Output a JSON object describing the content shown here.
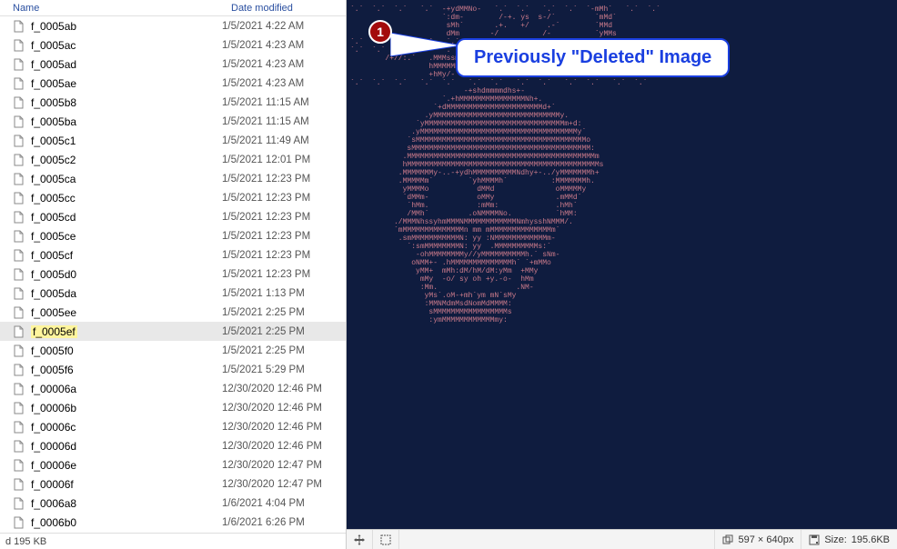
{
  "columns": {
    "name": "Name",
    "date": "Date modified"
  },
  "files": [
    {
      "name": "f_0005ab",
      "date": "1/5/2021 4:22 AM",
      "selected": false
    },
    {
      "name": "f_0005ac",
      "date": "1/5/2021 4:23 AM",
      "selected": false
    },
    {
      "name": "f_0005ad",
      "date": "1/5/2021 4:23 AM",
      "selected": false
    },
    {
      "name": "f_0005ae",
      "date": "1/5/2021 4:23 AM",
      "selected": false
    },
    {
      "name": "f_0005b8",
      "date": "1/5/2021 11:15 AM",
      "selected": false
    },
    {
      "name": "f_0005ba",
      "date": "1/5/2021 11:15 AM",
      "selected": false
    },
    {
      "name": "f_0005c1",
      "date": "1/5/2021 11:49 AM",
      "selected": false
    },
    {
      "name": "f_0005c2",
      "date": "1/5/2021 12:01 PM",
      "selected": false
    },
    {
      "name": "f_0005ca",
      "date": "1/5/2021 12:23 PM",
      "selected": false
    },
    {
      "name": "f_0005cc",
      "date": "1/5/2021 12:23 PM",
      "selected": false
    },
    {
      "name": "f_0005cd",
      "date": "1/5/2021 12:23 PM",
      "selected": false
    },
    {
      "name": "f_0005ce",
      "date": "1/5/2021 12:23 PM",
      "selected": false
    },
    {
      "name": "f_0005cf",
      "date": "1/5/2021 12:23 PM",
      "selected": false
    },
    {
      "name": "f_0005d0",
      "date": "1/5/2021 12:23 PM",
      "selected": false
    },
    {
      "name": "f_0005da",
      "date": "1/5/2021 1:13 PM",
      "selected": false
    },
    {
      "name": "f_0005ee",
      "date": "1/5/2021 2:25 PM",
      "selected": false
    },
    {
      "name": "f_0005ef",
      "date": "1/5/2021 2:25 PM",
      "selected": true
    },
    {
      "name": "f_0005f0",
      "date": "1/5/2021 2:25 PM",
      "selected": false
    },
    {
      "name": "f_0005f6",
      "date": "1/5/2021 5:29 PM",
      "selected": false
    },
    {
      "name": "f_00006a",
      "date": "12/30/2020 12:46 PM",
      "selected": false
    },
    {
      "name": "f_00006b",
      "date": "12/30/2020 12:46 PM",
      "selected": false
    },
    {
      "name": "f_00006c",
      "date": "12/30/2020 12:46 PM",
      "selected": false
    },
    {
      "name": "f_00006d",
      "date": "12/30/2020 12:46 PM",
      "selected": false
    },
    {
      "name": "f_00006e",
      "date": "12/30/2020 12:47 PM",
      "selected": false
    },
    {
      "name": "f_00006f",
      "date": "12/30/2020 12:47 PM",
      "selected": false
    },
    {
      "name": "f_0006a8",
      "date": "1/6/2021 4:04 PM",
      "selected": false
    },
    {
      "name": "f_0006b0",
      "date": "1/6/2021 6:26 PM",
      "selected": false
    }
  ],
  "left_status": "d  195 KB",
  "callout": {
    "badge": "1",
    "text": "Previously \"Deleted\" Image"
  },
  "right_status": {
    "dimensions": "597 × 640px",
    "size_label": "Size:",
    "size_value": "195.6KB"
  },
  "ascii_art": [
    "`.`  `.`  `.`   `.`  -+ydMMNo-   `.`  `.`   `.`  `.`  `-mMh`   `.`  `.`",
    "                     `:dm-        /-+. ys  s-/`         `mMd`",
    "                      sMh`       .+.   +/    .-`        `MMd",
    "                      dMm       -/          /-          `yMMs",
    "`.`  `.`  `.`   `.`   `.`       `.`  `.`   `.`  `.`   `.`  `.`   `.`",
    "",
    "`.`  `.`  `.`  `.`   `.`  `.`   `.`  `.`   `.`  `.`   `.`  `.`   `.`",
    "        /+//:.`   .MMMssmMMMy:    `:dMMNhs+sMMN`   .-:`-`.-/",
    "                  hMMMMMMd+.        :yMMMMMMMo.",
    "                  +hMy/-               /sdNMM/",
    "",
    "`.`  `.`  `.`   `.`  `.`   `.`  `.`   `.`  `.`   `.`  `.`   `.`  `.`",
    "",
    "                          -+shdmmmmdhs+-",
    "                     `.+hMMMMMMMMMMMMMMMNh+.",
    "                   `+dMMMMMMMMMMMMMMMMMMMMMMd+`",
    "                 .yMMMMMMMMMMMMMMMMMMMMMMMMMMMMMy.",
    "               `yMMMMMMMMMMMMMMMMMMMMMMMMMMMMMMMMm+d:",
    "              .yMMMMMMMMMMMMMMMMMMMMMMMMMMMMMMMMMMMMy`",
    "             `sMMMMMMMMMMMMMMMMMMMMMMMMMMMMMMMMMMMMMMMo",
    "             sMMMMMMMMMMMMMMMMMMMMMMMMMMMMMMMMMMMMMMMMM:",
    "            .MMMMMMMMMMMMMMMMMMMMMMMMMMMMMMMMMMMMMMMMMMMm",
    "            hMMMMMMMMMMMMMMMMMMMMMMMMMMMMMMMMMMMMMMMMMMMMs",
    "           .MMMMMMMy-..-+ydhMMMMMMMMMMNdhy+-../yMMMMMMMh+",
    "           .MMMMMm`        `yhMMMMh`          :MMMMMMMh.",
    "            yMMMMo           dMMd              oMMMMMy",
    "            `dMMm-           oMMy              .mMMd`",
    "             `hMm.           :mMm:             .hMh`",
    "             /MMh`         .oNMMMMNo.          `hMM:",
    "          ./MMMNhssyhmMMMNMMMMMMMMMMMMNmhysshNMMM/.",
    "          `mMMMMMMMMMMMMMMn mm mMMMMMMMMMMMMMMm`",
    "           .smMMMMMMMMMMMN: yy :NMMMMMMMMMMMMm-",
    "             `:smMMMMMMMMN: yy  .MMMMMMMMMMs:`",
    "               -ohMMMMMMMMy//yMMMMMMMMMMh.` sNm-",
    "              oNMM+- .hMMMMMMMMMMMMMMh` `+mMMo",
    "               yMM+  mMh:dM/hM/dM:yMm  +MMy",
    "                mMy  -o/ sy oh +y.-o-  hMm",
    "                :Mm.                  .NM-",
    "                 yMs`.oM-+mh`ym mN`sMy",
    "                 :MMNMdmMsdNomMdMMMM:",
    "                  sMMMMMMMMMMMMMMMMMs",
    "                  :ymMMMMMMMMMMMMmy:"
  ]
}
